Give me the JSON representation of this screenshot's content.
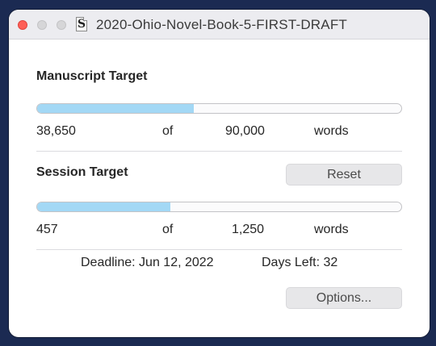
{
  "window": {
    "title": "2020-Ohio-Novel-Book-5-FIRST-DRAFT",
    "doc_icon_glyph": "S"
  },
  "manuscript": {
    "heading": "Manuscript Target",
    "progress": 0.4294,
    "current": "38,650",
    "of_label": "of",
    "target": "90,000",
    "unit": "words"
  },
  "session": {
    "heading": "Session Target",
    "reset_label": "Reset",
    "progress": 0.3656,
    "current": "457",
    "of_label": "of",
    "target": "1,250",
    "unit": "words"
  },
  "deadline": {
    "label": "Deadline: Jun 12, 2022",
    "days_left": "Days Left: 32"
  },
  "footer": {
    "options_label": "Options..."
  },
  "colors": {
    "progress_fill": "#a3d8f5",
    "close_button": "#fe5f57",
    "desktop_background": "#1b2a52"
  }
}
